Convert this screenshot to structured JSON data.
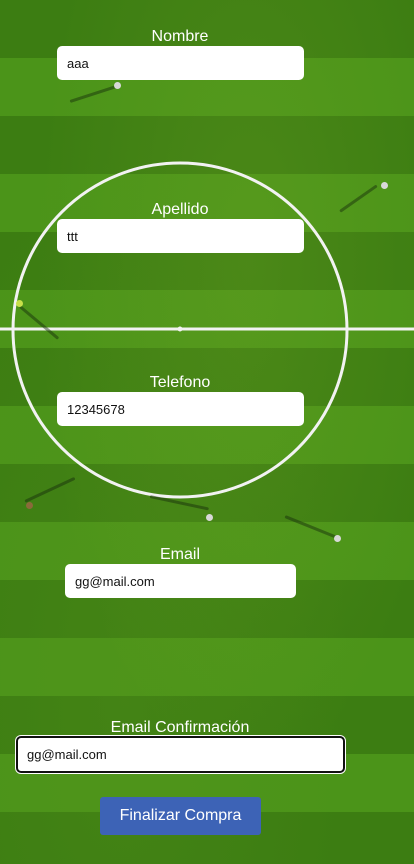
{
  "form": {
    "nombre": {
      "label": "Nombre",
      "value": "aaa"
    },
    "apellido": {
      "label": "Apellido",
      "value": "ttt"
    },
    "telefono": {
      "label": "Telefono",
      "value": "12345678"
    },
    "email": {
      "label": "Email",
      "value": "gg@mail.com"
    },
    "email_confirmacion": {
      "label": "Email Confirmación",
      "value": "gg@mail.com"
    },
    "submit_label": "Finalizar Compra"
  },
  "colors": {
    "submit_button": "#3d63b6",
    "pitch_green": "#3d7f14",
    "field_background": "#ffffff"
  }
}
